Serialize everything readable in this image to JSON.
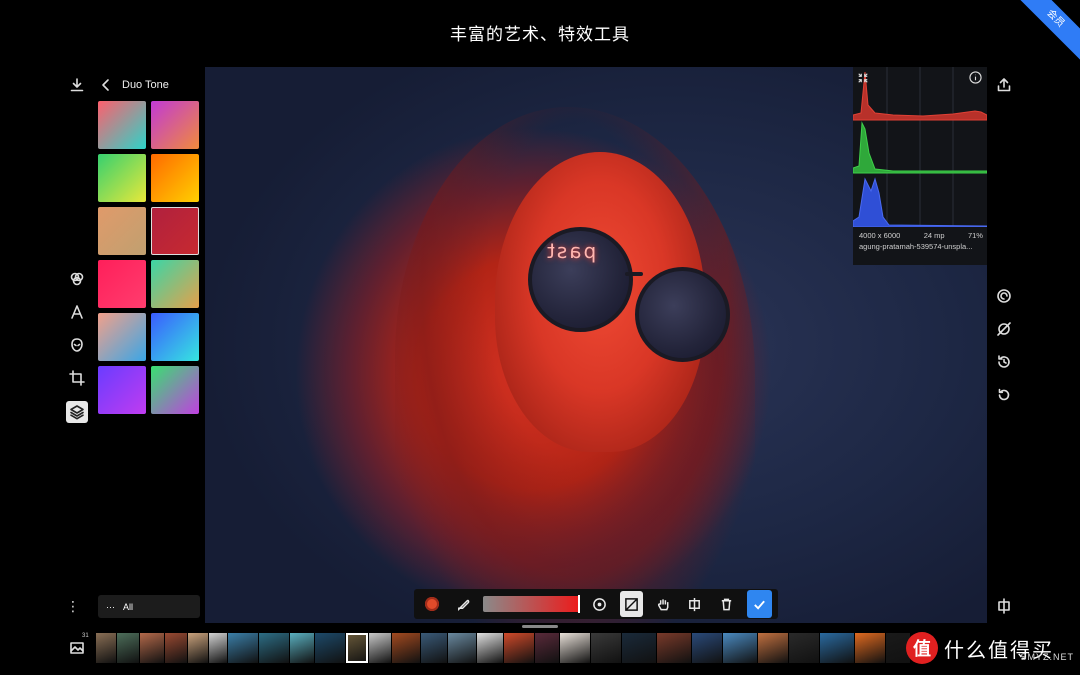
{
  "header": {
    "title": "丰富的艺术、特效工具",
    "badge": "会员"
  },
  "panel": {
    "back_icon": "chevron-left-icon",
    "title": "Duo Tone",
    "swatches": [
      {
        "c1": "#ff5f6d",
        "c2": "#2dd4c9"
      },
      {
        "c1": "#c03ad6",
        "c2": "#f08a3c"
      },
      {
        "c1": "#36d06f",
        "c2": "#e8e83a"
      },
      {
        "c1": "#ff6a00",
        "c2": "#ffd000"
      },
      {
        "c1": "#e09a6a",
        "c2": "#c0a070"
      },
      {
        "c1": "#b0203e",
        "c2": "#c72a30"
      },
      {
        "c1": "#ff1f5a",
        "c2": "#ff3d6e"
      },
      {
        "c1": "#3bd6a6",
        "c2": "#e6a04a"
      },
      {
        "c1": "#f2a08a",
        "c2": "#3aa6e6"
      },
      {
        "c1": "#3a5cff",
        "c2": "#36e6e0"
      },
      {
        "c1": "#6a3cff",
        "c2": "#c03cf0"
      },
      {
        "c1": "#38e070",
        "c2": "#c040e0"
      }
    ],
    "filter_label": "All",
    "filter_icon": "more-dots-icon"
  },
  "left_tools": {
    "download_icon": "download-icon",
    "filters_icon": "color-circles-icon",
    "text_icon": "text-icon",
    "mask_icon": "mask-icon",
    "crop_icon": "crop-icon",
    "layers_icon": "layers-icon",
    "more_icon": "more-vertical-icon"
  },
  "histogram": {
    "resolution": "4000 x 6000",
    "megapixels": "24 mp",
    "zoom": "71%",
    "filename": "agung-pratamah-539574-unspla...",
    "colors": {
      "red": "#c0392b",
      "green": "#2ecc40",
      "blue": "#2f4fd6"
    }
  },
  "photo": {
    "neon_text": "past"
  },
  "right_tools": {
    "share_icon": "share-icon",
    "spiral_icon": "spiral-icon",
    "no-retouch_icon": "slash-circle-icon",
    "history_icon": "history-icon",
    "undo_icon": "undo-icon",
    "compare_icon": "compare-icon"
  },
  "bottom_toolbar": {
    "brush_settings_icon": "brush-settings-icon",
    "feather_icon": "feather-icon",
    "opacity_value": 1.0,
    "target_icon": "target-icon",
    "invert_icon": "invert-mask-icon",
    "hand_icon": "hand-icon",
    "split_icon": "split-icon",
    "delete_icon": "trash-icon",
    "apply_icon": "check-icon"
  },
  "filmstrip": {
    "gallery_icon": "gallery-icon",
    "count": "31",
    "thumbs": [
      "#8a6f55",
      "#4d6e5a",
      "#b3694a",
      "#9a4a32",
      "#c9a27c",
      "#d2d2d2",
      "#3b7fa8",
      "#2d6e86",
      "#5ab0c0",
      "#1d4a6a",
      "#6a5a3a",
      "#c9c9c9",
      "#a34a20",
      "#3a5a78",
      "#6a8aa0",
      "#e0e0e0",
      "#d04a2a",
      "#5a2a3a",
      "#e8e0d8",
      "#3a3a3a",
      "#1a2a3a",
      "#7a3a2a",
      "#2a4a7a",
      "#4a8ac0",
      "#c07040",
      "#2a2a2a",
      "#2a6aa0",
      "#e06a20",
      "#1a1a1a"
    ],
    "selected_index": 10
  },
  "watermark": {
    "symbol": "值",
    "text": "什么值得买",
    "site": "SMYZ.NET"
  }
}
